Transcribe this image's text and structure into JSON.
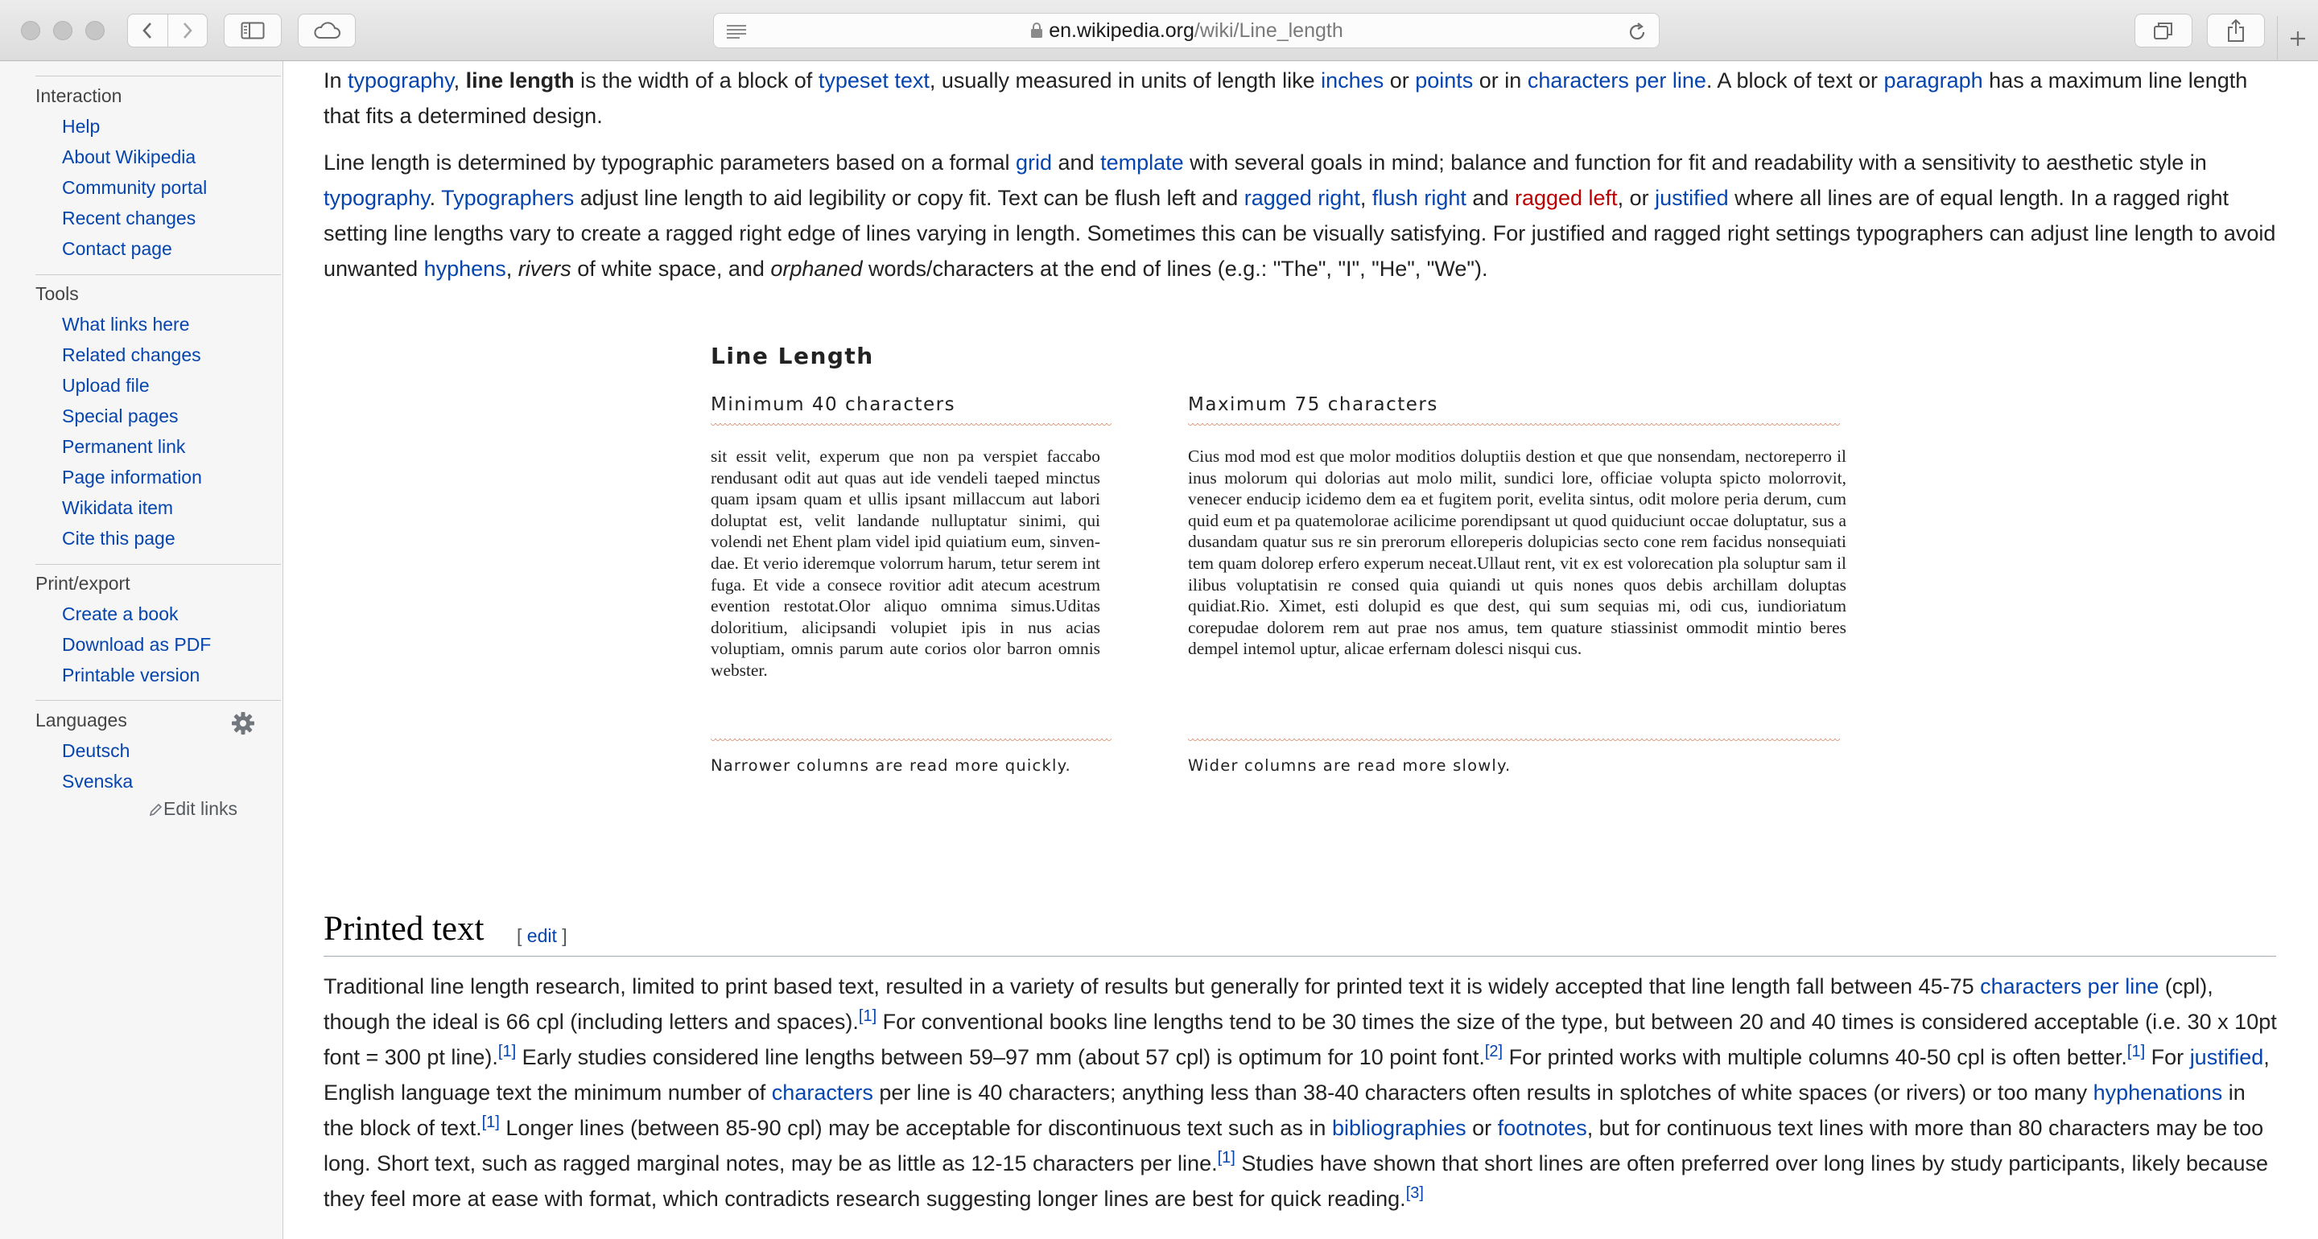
{
  "browser": {
    "url_host": "en.wikipedia.org",
    "url_path": "/wiki/Line_length",
    "icons": [
      "back-icon",
      "forward-icon",
      "sidebar-icon",
      "cloud-icon",
      "reader-icon",
      "lock-icon",
      "reload-icon",
      "tabs-icon",
      "share-icon",
      "plus-icon"
    ]
  },
  "sidebar": {
    "interaction": {
      "header": "Interaction",
      "items": [
        "Help",
        "About Wikipedia",
        "Community portal",
        "Recent changes",
        "Contact page"
      ]
    },
    "tools": {
      "header": "Tools",
      "items": [
        "What links here",
        "Related changes",
        "Upload file",
        "Special pages",
        "Permanent link",
        "Page information",
        "Wikidata item",
        "Cite this page"
      ]
    },
    "print": {
      "header": "Print/export",
      "items": [
        "Create a book",
        "Download as PDF",
        "Printable version"
      ]
    },
    "languages": {
      "header": "Languages",
      "items": [
        "Deutsch",
        "Svenska"
      ],
      "edit_links": "Edit links"
    }
  },
  "article": {
    "p1": {
      "t1": "In ",
      "l1": "typography",
      "t2": ", ",
      "b1": "line length",
      "t3": " is the width of a block of ",
      "l2": "typeset text",
      "t4": ", usually measured in units of length like ",
      "l3": "inches",
      "t5": " or ",
      "l4": "points",
      "t6": " or in ",
      "l5": "characters per line",
      "t7": ". A block of text or ",
      "l6": "paragraph",
      "t8": " has a maximum line length that fits a determined design."
    },
    "p2": {
      "t1": "Line length is determined by typographic parameters based on a formal ",
      "l1": "grid",
      "t2": " and ",
      "l2": "template",
      "t3": " with several goals in mind; balance and function for fit and readability with a sensitivity to aesthetic style in ",
      "l3": "typography",
      "t4": ". ",
      "l4": "Typographers",
      "t5": " adjust line length to aid legibility or copy fit. Text can be flush left and ",
      "l5": "ragged right",
      "t6": ", ",
      "l6": "flush right",
      "t7": " and ",
      "l7": "ragged left",
      "t8": ", or ",
      "l8": "justified",
      "t9": " where all lines are of equal length. In a ragged right setting line lengths vary to create a ragged right edge of lines varying in length. Sometimes this can be visually satisfying. For justified and ragged right settings typographers can adjust line length to avoid unwanted ",
      "l9": "hyphens",
      "t10": ", ",
      "i1": "rivers",
      "t11": " of white space, and ",
      "i2": "orphaned",
      "t12": " words/characters at the end of lines (e.g.: \"The\", \"I\", \"He\", \"We\")."
    },
    "figure": {
      "title": "Line Length",
      "min": {
        "header": "Minimum 40 characters",
        "text": "sit essit velit, experum que non pa verspiet faccabo rendusant odit aut quas aut ide ven­deli taeped minctus quam ipsam quam et ullis ipsant millaccum aut labori doluptat est, velit landande nulluptatur sinimi, qui volendi net Ehent plam videl ipid quiatium eum, sinven­dae. Et verio ideremque volorrum harum, tetur serem int fuga. Et vide a consece rovitior adit atecum acestrum evention restotat.Olor aliquo omnima simus.Uditas doloritium, alicipsandi volupiet ipis in nus acias voluptiam, omnis parum aute corios olor barron omnis webster.",
        "caption": "Narrower columns are read more quickly."
      },
      "max": {
        "header": "Maximum 75 characters",
        "text": "Cius mod mod est que molor moditios doluptiis destion et que que nonsen­dam, nectoreperro il inus molorum qui dolorias aut molo milit, sundici lore, officiae volupta spicto molorrovit, venecer endu­cip icidemo dem ea et fugitem porit, evelita sintus, odit molore peria derum, cum quid eum et pa quatemolo­rae acilicime porendipsant ut quod quiduciunt occae doluptatur, sus a dusan­dam quatur sus re sin prerorum elloreperis dolupicias secto cone rem facidus nonsequiati tem quam dolorep erfero experum neceat.Ullaut rent, vit ex est volorecation pla soluptur sam il ilibus voluptatisin re consed quia quiandi ut quis nones quos debis archillam doluptas quidiat.Rio. Ximet, esti dolupid es que dest, qui sum sequias mi, odi cus, iundioriatum corepudae dolorem rem aut prae nos amus, tem quature stiassinist ommodit mintio beres dempel inte­mol uptur, alicae erfernam dolesci nisqui cus.",
        "caption": "Wider columns are read more slowly."
      }
    },
    "section": {
      "title": "Printed text",
      "edit_open": "[ ",
      "edit": "edit",
      "edit_close": " ]"
    },
    "p3": {
      "t1": "Traditional line length research, limited to print based text, resulted in a variety of results but generally for printed text it is widely accepted that line length fall between 45-75 ",
      "l1": "characters per line",
      "t2": " (cpl), though the ideal is 66 cpl (including letters and spaces).",
      "r1": "[1]",
      "t3": " For conventional books line lengths tend to be 30 times the size of the type, but between 20 and 40 times is considered acceptable (i.e. 30 x 10pt font = 300 pt line).",
      "r2": "[1]",
      "t4": " Early studies considered line lengths between 59–97 mm (about 57 cpl) is optimum for 10 point font.",
      "r3": "[2]",
      "t5": " For printed works with multiple columns 40-50 cpl is often better.",
      "r4": "[1]",
      "t6": " For ",
      "l2": "justified",
      "t7": ", English language text the minimum number of ",
      "l3": "characters",
      "t8": " per line is 40 characters; anything less than 38-40 characters often results in splotches of white spaces (or rivers) or too many ",
      "l4": "hyphenations",
      "t9": " in the block of text.",
      "r5": "[1]",
      "t10": " Longer lines (between 85-90 cpl) may be acceptable for discontinuous text such as in ",
      "l5": "bibliographies",
      "t11": " or ",
      "l6": "footnotes",
      "t12": ", but for continuous text lines with more than 80 characters may be too long. Short text, such as ragged marginal notes, may be as little as 12-15 characters per line.",
      "r6": "[1]",
      "t13": " Studies have shown that short lines are often preferred over long lines by study participants, likely because they feel more at ease with format, which contradicts research suggesting longer lines are best for quick reading.",
      "r7": "[3]"
    }
  }
}
